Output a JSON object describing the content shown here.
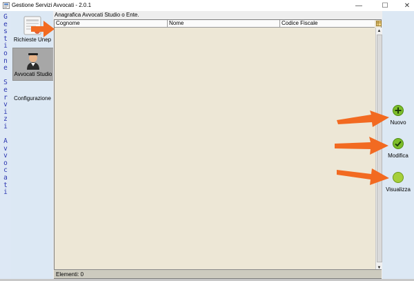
{
  "window": {
    "title": "Gestione Servizi Avvocati - 2.0.1",
    "controls": {
      "minimize": "—",
      "maximize": "☐",
      "close": "✕"
    }
  },
  "banner": {
    "text": "Gestione Servizi Avvocati"
  },
  "nav": {
    "items": [
      {
        "label": "Richieste Unep",
        "icon": "document-icon",
        "active": false
      },
      {
        "label": "Avvocati Studio",
        "icon": "lawyer-avatar-icon",
        "active": true
      },
      {
        "label": "Configurazione",
        "icon": "none",
        "active": false
      }
    ]
  },
  "panel": {
    "title": "Anagrafica Avvocati Studio o Ente.",
    "columns": [
      "Cognome",
      "Nome",
      "Codice Fiscale"
    ],
    "rows": [],
    "status": "Elementi: 0"
  },
  "actions": [
    {
      "label": "Nuovo",
      "icon": "plus-icon"
    },
    {
      "label": "Modifica",
      "icon": "check-icon"
    },
    {
      "label": "Visualizza",
      "icon": "view-icon"
    }
  ],
  "colors": {
    "accent_green": "#7cbd2a",
    "arrow_orange": "#f26a21",
    "banner_text": "#2a35b0",
    "table_background": "#ede7d6"
  }
}
